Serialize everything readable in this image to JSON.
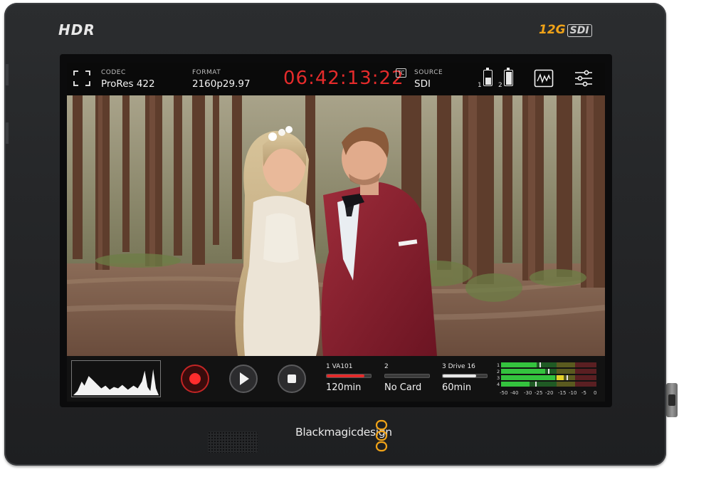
{
  "device": {
    "hdr_badge": "HDR",
    "sdi_badge_prefix": "12G",
    "sdi_badge_suffix": "SDI",
    "brand_logo": "Blackmagicdesign"
  },
  "topbar": {
    "codec_label": "CODEC",
    "codec_value": "ProRes 422",
    "format_label": "FORMAT",
    "format_value": "2160p29.97",
    "timecode": "06:42:13:22",
    "tc_badge": "TC",
    "source_label": "SOURCE",
    "source_value": "SDI",
    "battery_1_label": "1",
    "battery_2_label": "2",
    "battery_levels": [
      0.45,
      0.85
    ],
    "icons": [
      "frame-guides-icon",
      "scope-icon",
      "settings-sliders-icon"
    ]
  },
  "controls": {
    "icons": [
      "histogram-icon",
      "record-icon",
      "play-icon",
      "stop-icon"
    ],
    "record_color": "#ff2d2d"
  },
  "media": {
    "slots": [
      {
        "title": "1  VA101",
        "value": "120min",
        "fill": 0.85,
        "color": "#e52b2b"
      },
      {
        "title": "2",
        "value": "No Card",
        "fill": 0,
        "color": "#555555"
      },
      {
        "title": "3  Drive 16",
        "value": "60min",
        "fill": 0.75,
        "color": "#e8e8e8"
      }
    ]
  },
  "audio_meters": {
    "channels": [
      "1",
      "2",
      "3",
      "4"
    ],
    "scale": [
      "-50",
      "-40",
      "-30",
      "-25",
      "-20",
      "-15",
      "-10",
      "-5",
      "0"
    ]
  }
}
